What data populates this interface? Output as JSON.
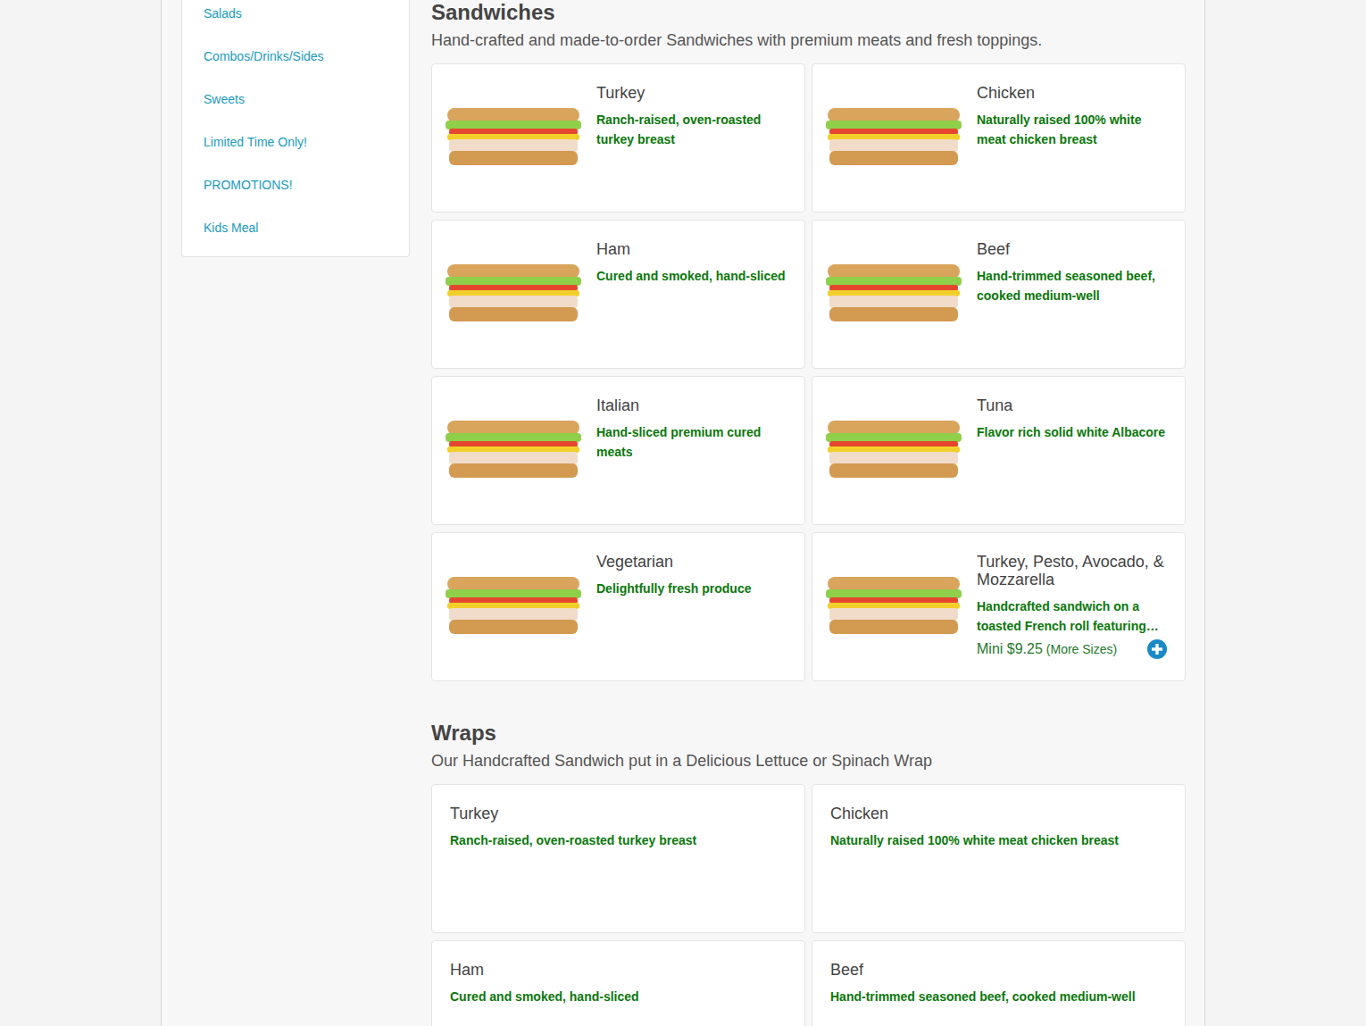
{
  "sidebar": {
    "items": [
      {
        "label": "Salads",
        "selected": false
      },
      {
        "label": "Combos/Drinks/Sides",
        "selected": false
      },
      {
        "label": "Sweets",
        "selected": false
      },
      {
        "label": "Limited Time Only!",
        "selected": false
      },
      {
        "label": "PROMOTIONS!",
        "selected": false
      },
      {
        "label": "Kids Meal",
        "selected": false
      }
    ]
  },
  "sections": [
    {
      "title": "Sandwiches",
      "subtitle": "Hand-crafted and made-to-order Sandwiches with premium meats and fresh toppings.",
      "items": [
        {
          "kind": "photo",
          "name": "Turkey",
          "description": "Ranch-raised, oven-roasted turkey breast"
        },
        {
          "kind": "photo",
          "name": "Chicken",
          "description": "Naturally raised 100% white meat chicken breast"
        },
        {
          "kind": "photo",
          "name": "Ham",
          "description": "Cured and smoked, hand-sliced"
        },
        {
          "kind": "photo",
          "name": "Beef",
          "description": "Hand-trimmed seasoned beef, cooked medium-well"
        },
        {
          "kind": "photo",
          "name": "Italian",
          "description": "Hand-sliced premium cured meats"
        },
        {
          "kind": "photo",
          "name": "Tuna",
          "description": "Flavor rich solid white Albacore"
        },
        {
          "kind": "photo",
          "name": "Vegetarian",
          "description": "Delightfully fresh produce"
        },
        {
          "kind": "photo-priced",
          "name": "Turkey, Pesto, Avocado, & Mozzarella",
          "description": "Handcrafted sandwich on a toasted French roll featuring…",
          "price": "Mini $9.25",
          "more": "(More Sizes)"
        }
      ]
    },
    {
      "title": "Wraps",
      "subtitle": "Our Handcrafted Sandwich put in a Delicious Lettuce or Spinach Wrap",
      "items": [
        {
          "kind": "text",
          "name": "Turkey",
          "description": "Ranch-raised, oven-roasted turkey breast"
        },
        {
          "kind": "text",
          "name": "Chicken",
          "description": "Naturally raised 100% white meat chicken breast"
        },
        {
          "kind": "text",
          "name": "Ham",
          "description": "Cured and smoked, hand-sliced"
        },
        {
          "kind": "text",
          "name": "Beef",
          "description": "Hand-trimmed seasoned beef, cooked medium-well"
        }
      ]
    }
  ]
}
